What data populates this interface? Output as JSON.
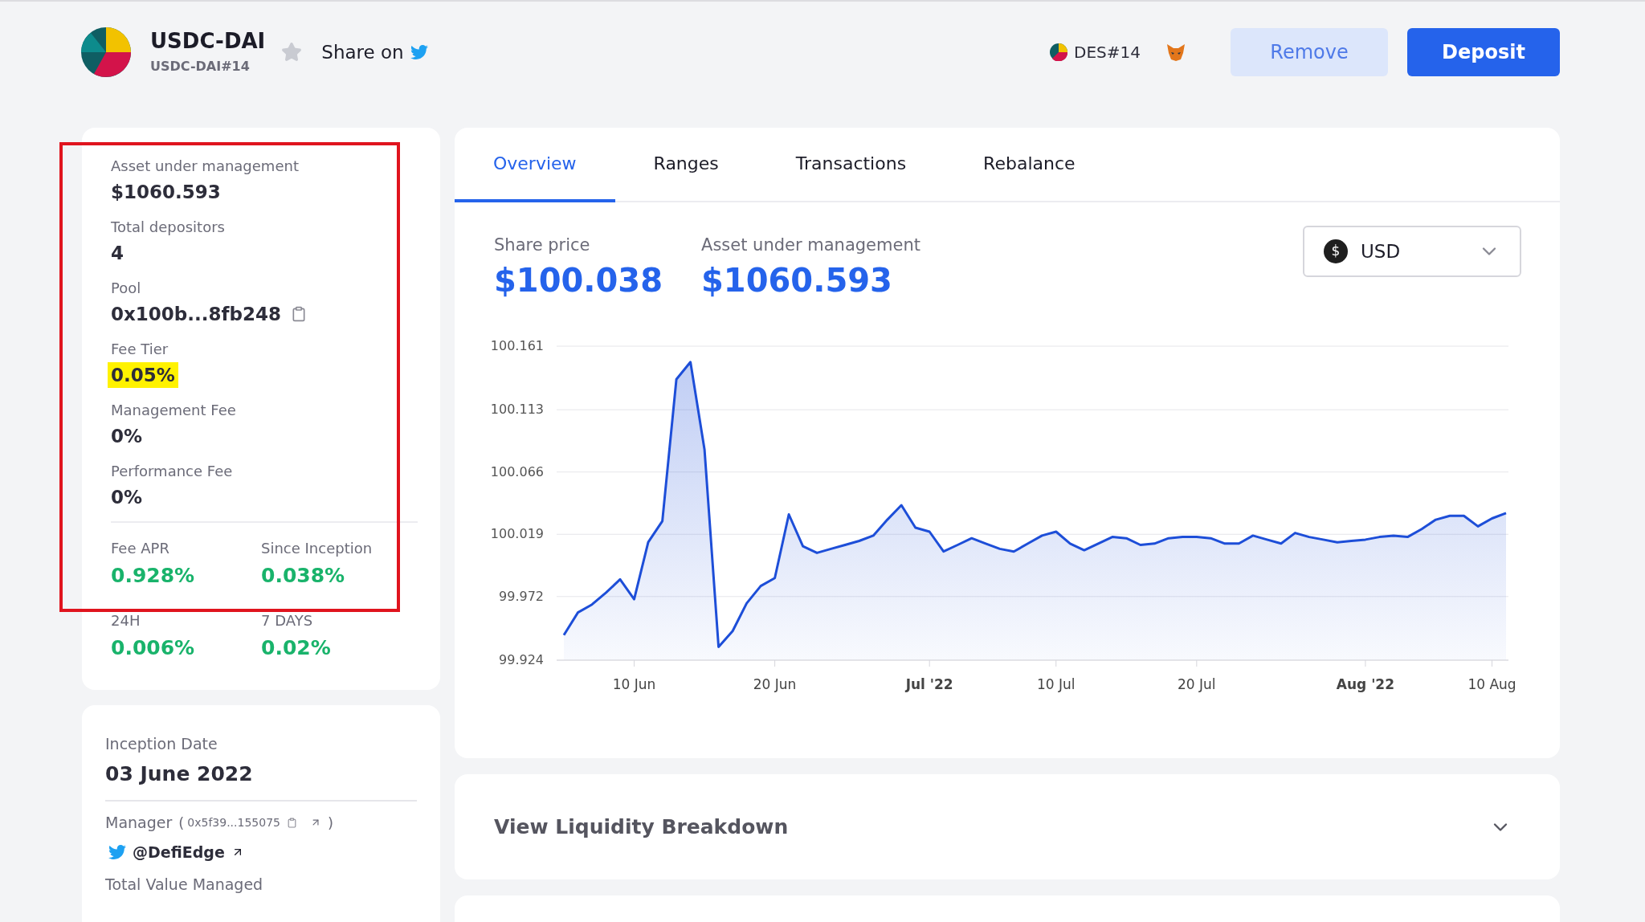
{
  "header": {
    "title": "USDC-DAI",
    "subtitle": "USDC-DAI#14",
    "share_label": "Share on",
    "account": "DES#14",
    "buttons": [
      {
        "label": "Remove",
        "kind": "secondary"
      },
      {
        "label": "Deposit",
        "kind": "primary"
      }
    ]
  },
  "summary_card": {
    "annotated": true,
    "stats": [
      {
        "label": "Asset under management",
        "value": "$1060.593",
        "kind": "plain",
        "highlighted": false
      },
      {
        "label": "Total depositors",
        "value": "4",
        "kind": "plain",
        "highlighted": false
      },
      {
        "label": "Pool",
        "value": "0x100b...8fb248",
        "kind": "address",
        "highlighted": false
      },
      {
        "label": "Fee Tier",
        "value": "0.05%",
        "kind": "plain",
        "highlighted": true
      },
      {
        "label": "Management Fee",
        "value": "0%",
        "kind": "plain",
        "highlighted": false
      },
      {
        "label": "Performance Fee",
        "value": "0%",
        "kind": "plain",
        "highlighted": false
      }
    ],
    "fee_returns": [
      {
        "label": "Fee APR",
        "value": "0.928%"
      },
      {
        "label": "Since Inception",
        "value": "0.038%"
      }
    ],
    "period_returns": [
      {
        "label": "24H",
        "value": "0.006%"
      },
      {
        "label": "7 DAYS",
        "value": "0.02%"
      }
    ]
  },
  "manager_card": {
    "inception_label": "Inception Date",
    "inception_date": "03 June 2022",
    "manager_label": "Manager",
    "manager_open": "(",
    "manager_address": "0x5f39...155075",
    "manager_close": ")",
    "twitter_handle": "@DefiEdge",
    "total_value_label": "Total Value Managed"
  },
  "main": {
    "tabs": [
      {
        "label": "Overview",
        "selected": true
      },
      {
        "label": "Ranges",
        "selected": false
      },
      {
        "label": "Transactions",
        "selected": false
      },
      {
        "label": "Rebalance",
        "selected": false
      }
    ],
    "share_price_label": "Share price",
    "share_price": "$100.038",
    "aum_label": "Asset under management",
    "aum": "$1060.593",
    "currency": "USD",
    "currency_symbol": "$",
    "chart_data": {
      "type": "area",
      "categories": [
        null,
        null,
        null,
        null,
        null,
        "10 Jun",
        null,
        null,
        null,
        null,
        null,
        null,
        null,
        null,
        null,
        "20 Jun",
        null,
        null,
        null,
        null,
        null,
        null,
        null,
        null,
        null,
        null,
        "Jul '22",
        null,
        null,
        null,
        null,
        null,
        null,
        null,
        null,
        "10 Jul",
        null,
        null,
        null,
        null,
        null,
        null,
        null,
        null,
        null,
        "20 Jul",
        null,
        null,
        null,
        null,
        null,
        null,
        null,
        null,
        null,
        null,
        null,
        "Aug '22",
        null,
        null,
        null,
        null,
        null,
        null,
        null,
        null,
        "10 Aug",
        null
      ],
      "series": [
        {
          "color": "#1d4ed8",
          "values": [
            99.943,
            99.96,
            99.966,
            99.975,
            99.985,
            99.97,
            100.013,
            100.029,
            100.136,
            100.149,
            100.083,
            99.934,
            99.946,
            99.967,
            99.98,
            99.986,
            100.034,
            100.01,
            100.005,
            100.008,
            100.011,
            100.014,
            100.018,
            100.03,
            100.041,
            100.024,
            100.021,
            100.006,
            100.011,
            100.016,
            100.012,
            100.008,
            100.006,
            100.012,
            100.018,
            100.021,
            100.012,
            100.007,
            100.012,
            100.017,
            100.016,
            100.011,
            100.012,
            100.016,
            100.017,
            100.017,
            100.016,
            100.012,
            100.012,
            100.018,
            100.015,
            100.012,
            100.02,
            100.017,
            100.015,
            100.013,
            100.014,
            100.015,
            100.017,
            100.018,
            100.017,
            100.023,
            100.03,
            100.033,
            100.033,
            100.025,
            100.031,
            100.035
          ]
        }
      ],
      "ylim": [
        99.924,
        100.161
      ],
      "grid": true,
      "yticks": [
        99.924,
        99.972,
        100.019,
        100.066,
        100.113,
        100.161
      ]
    }
  },
  "liquidity": {
    "title": "View Liquidity Breakdown",
    "expanded": false
  }
}
